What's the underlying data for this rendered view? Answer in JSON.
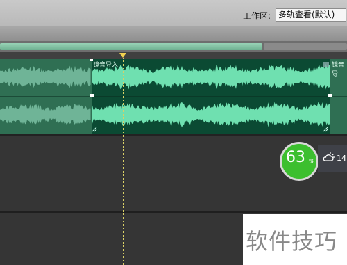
{
  "toolbar": {
    "workspace_label": "工作区:",
    "workspace_value": "多轨查看(默认)"
  },
  "tracks": {
    "clip_label_1": "镜音导入",
    "clip_label_2": "镜音导"
  },
  "overlay": {
    "percent_value": "63",
    "percent_unit": "%",
    "weather_temp": "14",
    "weather_icon": "cloud-sun-icon"
  },
  "watermark": "软件技巧",
  "colors": {
    "waveform": "#6fe0b0",
    "clip_selected_bg": "#0b4a33",
    "clip_unselected_bg": "#2f6f53",
    "badge": "#3cbf2f"
  }
}
